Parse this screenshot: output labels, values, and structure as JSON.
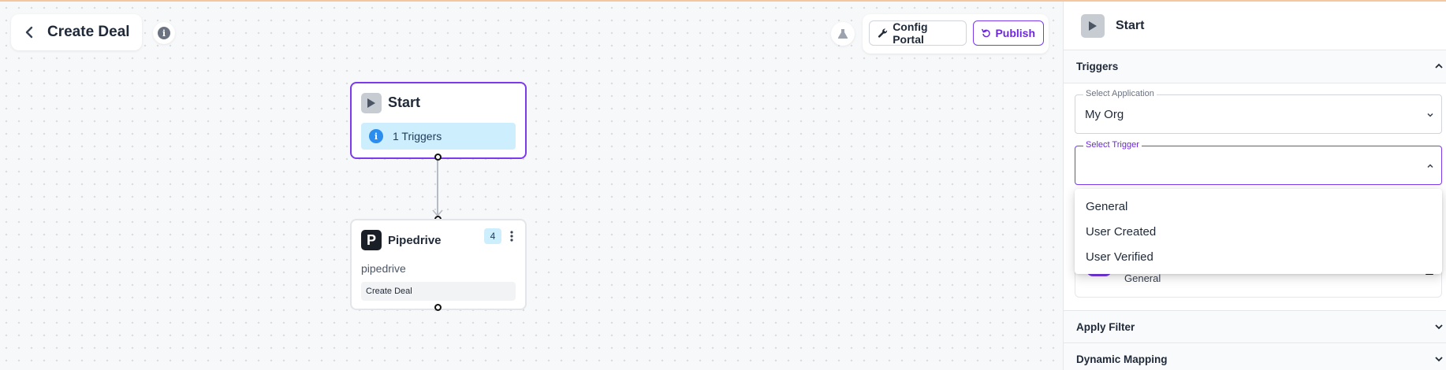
{
  "header": {
    "title": "Create Deal"
  },
  "toolbar": {
    "config_label": "Config Portal",
    "publish_label": "Publish"
  },
  "flow": {
    "start_node": {
      "title": "Start",
      "badge": "1 Triggers"
    },
    "pipedrive_node": {
      "title": "Pipedrive",
      "logo_letter": "P",
      "count": "4",
      "subtitle": "pipedrive",
      "action": "Create Deal"
    }
  },
  "panel": {
    "title": "Start",
    "triggers_section": "Triggers",
    "select_application": {
      "label": "Select Application",
      "value": "My Org"
    },
    "select_trigger": {
      "label": "Select Trigger",
      "value": ""
    },
    "trigger_options": [
      "General",
      "User Created",
      "User Verified"
    ],
    "behind_card_text": "General",
    "apply_filter_section": "Apply Filter",
    "dynamic_mapping_section": "Dynamic Mapping"
  },
  "colors": {
    "accent": "#7c3aed",
    "badge_bg": "#cdeefc",
    "info_blue": "#2b8ded"
  }
}
